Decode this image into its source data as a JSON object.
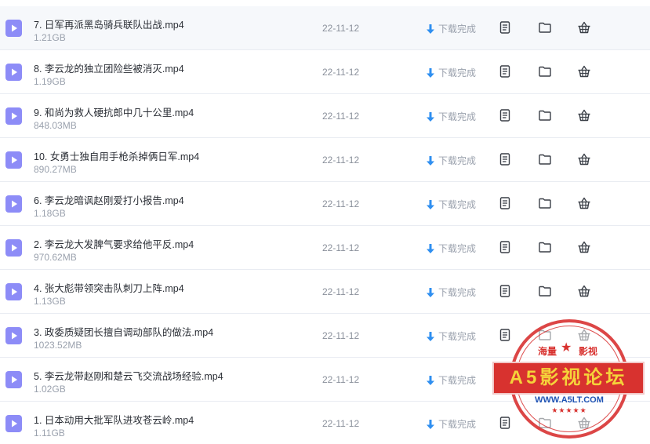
{
  "status_label": "下载完成",
  "icons": {
    "file": "play-file-icon",
    "status": "download-arrow-icon",
    "doc": "document-icon",
    "folder": "folder-icon",
    "basket": "basket-icon"
  },
  "colors": {
    "file_icon_bg": "#8d8cf7",
    "download_arrow": "#2f8ff0",
    "first_row_bg": "#f6f8fb"
  },
  "files": [
    {
      "name": "7. 日军再派黑岛骑兵联队出战.mp4",
      "size": "1.21GB",
      "date": "22-11-12"
    },
    {
      "name": "8. 李云龙的独立团险些被消灭.mp4",
      "size": "1.19GB",
      "date": "22-11-12"
    },
    {
      "name": "9. 和尚为救人硬抗郎中几十公里.mp4",
      "size": "848.03MB",
      "date": "22-11-12"
    },
    {
      "name": "10. 女勇士独自用手枪杀掉俩日军.mp4",
      "size": "890.27MB",
      "date": "22-11-12"
    },
    {
      "name": "6. 李云龙暗讽赵刚爱打小报告.mp4",
      "size": "1.18GB",
      "date": "22-11-12"
    },
    {
      "name": "2. 李云龙大发脾气要求给他平反.mp4",
      "size": "970.62MB",
      "date": "22-11-12"
    },
    {
      "name": "4. 张大彪带领突击队刺刀上阵.mp4",
      "size": "1.13GB",
      "date": "22-11-12"
    },
    {
      "name": "3. 政委质疑团长擅自调动部队的做法.mp4",
      "size": "1023.52MB",
      "date": "22-11-12"
    },
    {
      "name": "5. 李云龙带赵刚和楚云飞交流战场经验.mp4",
      "size": "1.02GB",
      "date": "22-11-12"
    },
    {
      "name": "1. 日本动用大批军队进攻苍云岭.mp4",
      "size": "1.11GB",
      "date": "22-11-12"
    }
  ],
  "watermark": {
    "top_left": "海量",
    "top_right": "影视",
    "main": "A5影视论坛",
    "url": "WWW.A5LT.COM",
    "stars": "★★★★★"
  }
}
